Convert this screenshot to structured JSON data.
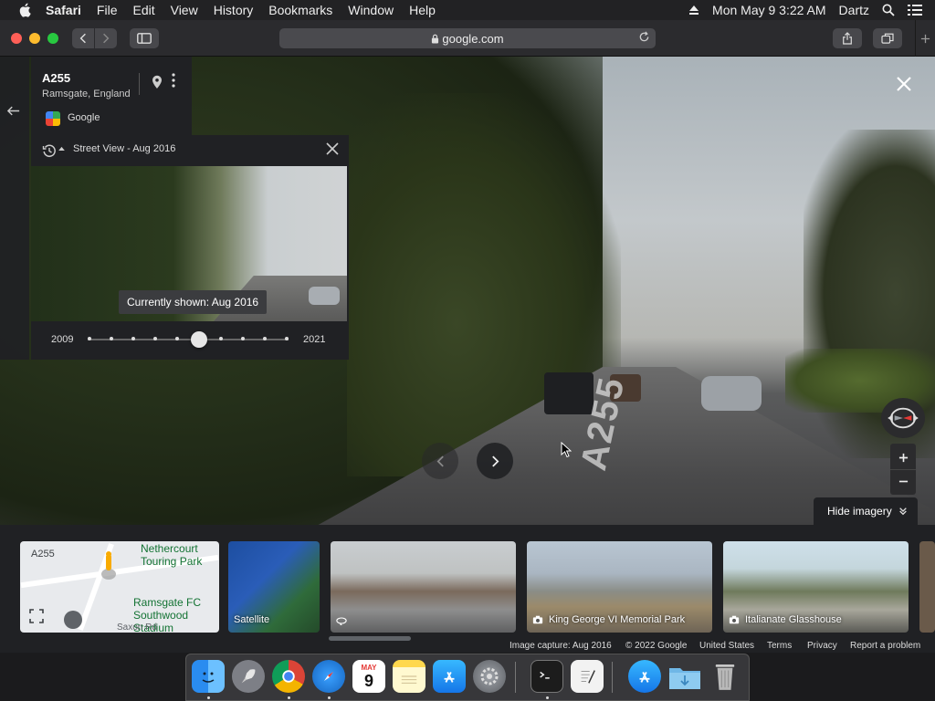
{
  "menubar": {
    "app_name": "Safari",
    "items": [
      "File",
      "Edit",
      "View",
      "History",
      "Bookmarks",
      "Window",
      "Help"
    ],
    "datetime": "Mon May 9  3:22 AM",
    "user": "Dartz"
  },
  "browser": {
    "url": "google.com"
  },
  "place": {
    "title": "A255",
    "subtitle": "Ramsgate, England",
    "provider": "Google"
  },
  "time_machine": {
    "title": "Street View - Aug 2016",
    "tooltip": "Currently shown: Aug 2016",
    "year_start": "2009",
    "year_end": "2021",
    "selected_index": 5,
    "dot_count": 10
  },
  "scene": {
    "road_label": "A255"
  },
  "controls": {
    "hide_imagery_label": "Hide imagery"
  },
  "cards": {
    "map_road_label": "A255",
    "map_place1_line1": "Nethercourt",
    "map_place1_line2": "Touring Park",
    "map_place2_line1": "Ramsgate FC",
    "map_place2_line2": "Southwood Stadium",
    "map_bottom_label": "Saxon Rd",
    "satellite_label": "Satellite",
    "photo2_label": "King George VI Memorial Park",
    "photo3_label": "Italianate Glasshouse"
  },
  "footer": {
    "capture": "Image capture: Aug 2016",
    "copyright": "© 2022 Google",
    "region": "United States",
    "terms": "Terms",
    "privacy": "Privacy",
    "report": "Report a problem"
  },
  "dock": {
    "calendar_month": "MAY",
    "calendar_day": "9"
  },
  "colors": {
    "panel_bg": "#202124",
    "google_green_text": "#137333",
    "compass_red": "#e53935"
  }
}
